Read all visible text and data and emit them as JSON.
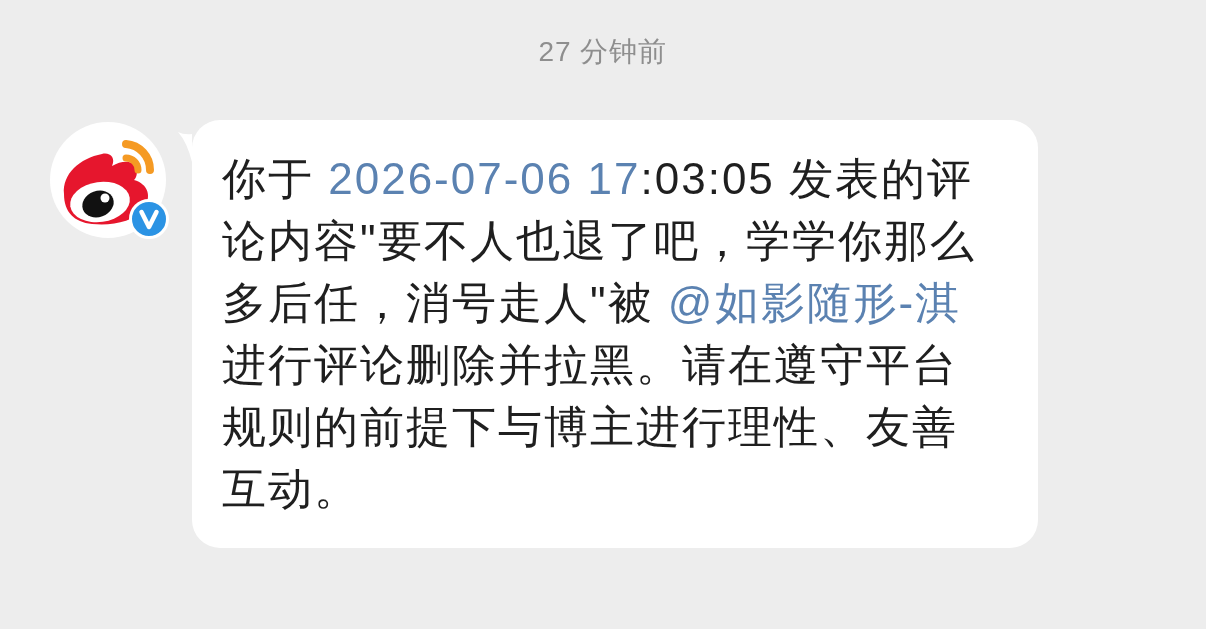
{
  "timestamp": "27 分钟前",
  "message": {
    "avatar": {
      "verified": true
    },
    "segments": [
      {
        "kind": "text",
        "text": "你于 "
      },
      {
        "kind": "date",
        "text": "2026-07-06 17"
      },
      {
        "kind": "text",
        "text": ":03:05 发表的评论内容\"要不人也退了吧，学学你那么多后任，消号走人\"被 "
      },
      {
        "kind": "mention",
        "text": "@如影随形-淇"
      },
      {
        "kind": "text",
        "text": "进行评论删除并拉黑。请在遵守平台规则的前提下与博主进行理性、友善互动。"
      }
    ]
  }
}
